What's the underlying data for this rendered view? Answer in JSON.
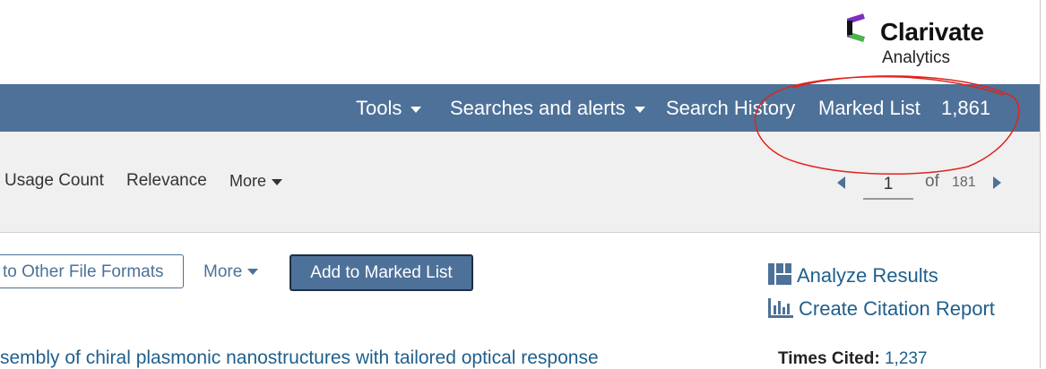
{
  "brand": {
    "name": "Clarivate",
    "subtitle": "Analytics",
    "logo_icon": "clarivate-logo",
    "colors": {
      "purple": "#7b2fbe",
      "green": "#48b648",
      "dark": "#111111"
    }
  },
  "nav": {
    "tools": "Tools",
    "searches_alerts": "Searches and alerts",
    "search_history": "Search History",
    "marked_list": "Marked List",
    "marked_count": "1,861",
    "background": "#4d7198"
  },
  "sort": {
    "usage_count": "Usage Count",
    "relevance": "Relevance",
    "more": "More"
  },
  "pager": {
    "current_page": "1",
    "of_label": "of",
    "total_pages": "181"
  },
  "actions": {
    "export_label": "to Other File Formats",
    "more_label": "More",
    "add_to_marked_list": "Add to Marked List",
    "analyze_results": "Analyze Results",
    "create_citation_report": "Create Citation Report"
  },
  "result": {
    "title": "sembly of chiral plasmonic nanostructures with tailored optical response",
    "times_cited_label": "Times Cited:",
    "times_cited_value": "1,237"
  },
  "annotation": {
    "shape": "red-hand-drawn-circle",
    "color": "#e0231e"
  }
}
